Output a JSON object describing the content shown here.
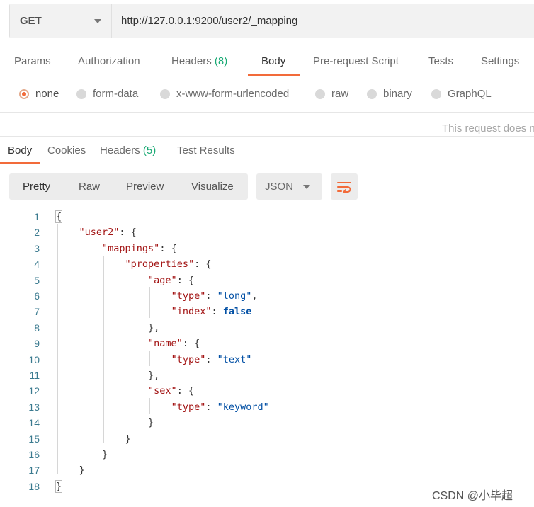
{
  "request": {
    "method": "GET",
    "url": "http://127.0.0.1:9200/user2/_mapping"
  },
  "request_tabs": [
    {
      "label": "Params",
      "count": ""
    },
    {
      "label": "Authorization",
      "count": ""
    },
    {
      "label": "Headers",
      "count": "(8)"
    },
    {
      "label": "Body",
      "count": "",
      "active": true
    },
    {
      "label": "Pre-request Script",
      "count": ""
    },
    {
      "label": "Tests",
      "count": ""
    },
    {
      "label": "Settings",
      "count": ""
    }
  ],
  "body_types": [
    {
      "label": "none",
      "selected": true
    },
    {
      "label": "form-data"
    },
    {
      "label": "x-www-form-urlencoded"
    },
    {
      "label": "raw"
    },
    {
      "label": "binary"
    },
    {
      "label": "GraphQL"
    }
  ],
  "body_notice": "This request does n",
  "response_tabs": [
    {
      "label": "Body",
      "count": "",
      "active": true
    },
    {
      "label": "Cookies",
      "count": ""
    },
    {
      "label": "Headers",
      "count": "(5)"
    },
    {
      "label": "Test Results",
      "count": ""
    }
  ],
  "view_modes": [
    "Pretty",
    "Raw",
    "Preview",
    "Visualize"
  ],
  "active_view": "Pretty",
  "format": "JSON",
  "icons": {
    "method_caret": "chevron-down-icon",
    "format_caret": "chevron-down-icon",
    "wrap": "wrap-lines-icon"
  },
  "colors": {
    "accent": "#f26b3a",
    "count": "#19a974",
    "json_key": "#a31515",
    "json_value": "#0451a5",
    "line_number": "#3a7a8f"
  },
  "response_lines": [
    {
      "n": "1",
      "tokens": [
        {
          "t": "p",
          "v": "{"
        }
      ]
    },
    {
      "n": "2",
      "tokens": [
        {
          "t": "p",
          "v": "    "
        },
        {
          "t": "k",
          "v": "\"user2\""
        },
        {
          "t": "p",
          "v": ": {"
        }
      ]
    },
    {
      "n": "3",
      "tokens": [
        {
          "t": "p",
          "v": "        "
        },
        {
          "t": "k",
          "v": "\"mappings\""
        },
        {
          "t": "p",
          "v": ": {"
        }
      ]
    },
    {
      "n": "4",
      "tokens": [
        {
          "t": "p",
          "v": "            "
        },
        {
          "t": "k",
          "v": "\"properties\""
        },
        {
          "t": "p",
          "v": ": {"
        }
      ]
    },
    {
      "n": "5",
      "tokens": [
        {
          "t": "p",
          "v": "                "
        },
        {
          "t": "k",
          "v": "\"age\""
        },
        {
          "t": "p",
          "v": ": {"
        }
      ]
    },
    {
      "n": "6",
      "tokens": [
        {
          "t": "p",
          "v": "                    "
        },
        {
          "t": "k",
          "v": "\"type\""
        },
        {
          "t": "p",
          "v": ": "
        },
        {
          "t": "s",
          "v": "\"long\""
        },
        {
          "t": "p",
          "v": ","
        }
      ]
    },
    {
      "n": "7",
      "tokens": [
        {
          "t": "p",
          "v": "                    "
        },
        {
          "t": "k",
          "v": "\"index\""
        },
        {
          "t": "p",
          "v": ": "
        },
        {
          "t": "b",
          "v": "false"
        }
      ]
    },
    {
      "n": "8",
      "tokens": [
        {
          "t": "p",
          "v": "                },"
        }
      ]
    },
    {
      "n": "9",
      "tokens": [
        {
          "t": "p",
          "v": "                "
        },
        {
          "t": "k",
          "v": "\"name\""
        },
        {
          "t": "p",
          "v": ": {"
        }
      ]
    },
    {
      "n": "10",
      "tokens": [
        {
          "t": "p",
          "v": "                    "
        },
        {
          "t": "k",
          "v": "\"type\""
        },
        {
          "t": "p",
          "v": ": "
        },
        {
          "t": "s",
          "v": "\"text\""
        }
      ]
    },
    {
      "n": "11",
      "tokens": [
        {
          "t": "p",
          "v": "                },"
        }
      ]
    },
    {
      "n": "12",
      "tokens": [
        {
          "t": "p",
          "v": "                "
        },
        {
          "t": "k",
          "v": "\"sex\""
        },
        {
          "t": "p",
          "v": ": {"
        }
      ]
    },
    {
      "n": "13",
      "tokens": [
        {
          "t": "p",
          "v": "                    "
        },
        {
          "t": "k",
          "v": "\"type\""
        },
        {
          "t": "p",
          "v": ": "
        },
        {
          "t": "s",
          "v": "\"keyword\""
        }
      ]
    },
    {
      "n": "14",
      "tokens": [
        {
          "t": "p",
          "v": "                }"
        }
      ]
    },
    {
      "n": "15",
      "tokens": [
        {
          "t": "p",
          "v": "            }"
        }
      ]
    },
    {
      "n": "16",
      "tokens": [
        {
          "t": "p",
          "v": "        }"
        }
      ]
    },
    {
      "n": "17",
      "tokens": [
        {
          "t": "p",
          "v": "    }"
        }
      ]
    },
    {
      "n": "18",
      "tokens": [
        {
          "t": "p",
          "v": "}"
        }
      ]
    }
  ],
  "watermark": "CSDN @小毕超"
}
